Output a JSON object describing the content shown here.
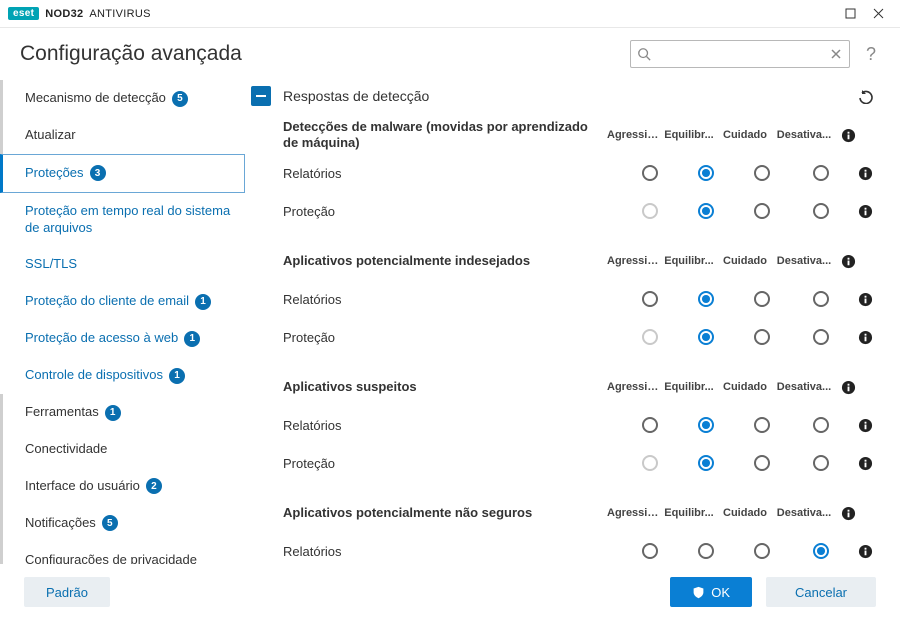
{
  "app": {
    "brand_eset": "eset",
    "brand_nod32": "NOD32",
    "brand_av": "ANTIVIRUS"
  },
  "header": {
    "title": "Configuração avançada",
    "search_placeholder": "",
    "help": "?"
  },
  "sidebar": {
    "items": [
      {
        "label": "Mecanismo de detecção",
        "badge": "5",
        "kind": "top"
      },
      {
        "label": "Atualizar",
        "kind": "top"
      },
      {
        "label": "Proteções",
        "badge": "3",
        "kind": "top-sel"
      },
      {
        "label": "Proteção em tempo real do sistema de arquivos",
        "kind": "sub"
      },
      {
        "label": "SSL/TLS",
        "kind": "sub"
      },
      {
        "label": "Proteção do cliente de email",
        "badge": "1",
        "kind": "sub"
      },
      {
        "label": "Proteção de acesso à web",
        "badge": "1",
        "kind": "sub"
      },
      {
        "label": "Controle de dispositivos",
        "badge": "1",
        "kind": "sub"
      },
      {
        "label": "Ferramentas",
        "badge": "1",
        "kind": "top"
      },
      {
        "label": "Conectividade",
        "kind": "top"
      },
      {
        "label": "Interface do usuário",
        "badge": "2",
        "kind": "top"
      },
      {
        "label": "Notificações",
        "badge": "5",
        "kind": "top"
      },
      {
        "label": "Configurações de privacidade",
        "kind": "top"
      }
    ]
  },
  "main": {
    "section_title": "Respostas de detecção",
    "col_headers": [
      "Agressivo",
      "Equilibr...",
      "Cuidado",
      "Desativa..."
    ],
    "groups": [
      {
        "title": "Detecções de malware (movidas por aprendizado de máquina)",
        "rows": [
          {
            "label": "Relatórios",
            "sel": 1,
            "disabled": []
          },
          {
            "label": "Proteção",
            "sel": 1,
            "disabled": [
              0
            ]
          }
        ]
      },
      {
        "title": "Aplicativos potencialmente indesejados",
        "rows": [
          {
            "label": "Relatórios",
            "sel": 1,
            "disabled": []
          },
          {
            "label": "Proteção",
            "sel": 1,
            "disabled": [
              0
            ]
          }
        ]
      },
      {
        "title": "Aplicativos suspeitos",
        "rows": [
          {
            "label": "Relatórios",
            "sel": 1,
            "disabled": []
          },
          {
            "label": "Proteção",
            "sel": 1,
            "disabled": [
              0
            ]
          }
        ]
      },
      {
        "title": "Aplicativos potencialmente não seguros",
        "rows": [
          {
            "label": "Relatórios",
            "sel": 3,
            "disabled": []
          }
        ]
      }
    ]
  },
  "footer": {
    "default": "Padrão",
    "ok": "OK",
    "cancel": "Cancelar"
  }
}
